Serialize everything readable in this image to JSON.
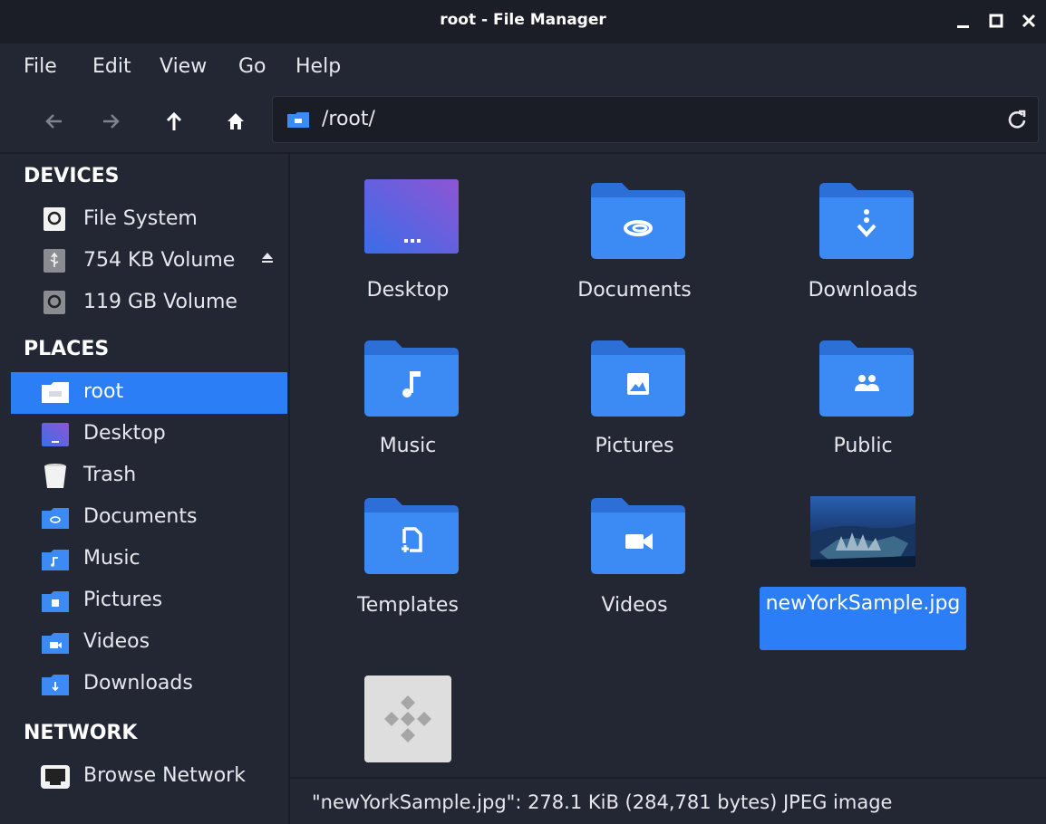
{
  "window": {
    "title": "root - File Manager"
  },
  "menu": {
    "items": [
      "File",
      "Edit",
      "View",
      "Go",
      "Help"
    ]
  },
  "toolbar": {
    "path": "/root/"
  },
  "sidebar": {
    "devices_heading": "DEVICES",
    "devices": [
      {
        "label": "File System",
        "icon": "drive-icon"
      },
      {
        "label": "754 KB Volume",
        "icon": "usb-drive-icon",
        "eject": true
      },
      {
        "label": "119 GB Volume",
        "icon": "drive-icon"
      }
    ],
    "places_heading": "PLACES",
    "places": [
      {
        "label": "root",
        "icon": "home-folder-icon",
        "selected": true
      },
      {
        "label": "Desktop",
        "icon": "desktop-folder-icon"
      },
      {
        "label": "Trash",
        "icon": "trash-icon"
      },
      {
        "label": "Documents",
        "icon": "documents-folder-icon"
      },
      {
        "label": "Music",
        "icon": "music-folder-icon"
      },
      {
        "label": "Pictures",
        "icon": "pictures-folder-icon"
      },
      {
        "label": "Videos",
        "icon": "videos-folder-icon"
      },
      {
        "label": "Downloads",
        "icon": "downloads-folder-icon"
      }
    ],
    "network_heading": "NETWORK",
    "network": [
      {
        "label": "Browse Network",
        "icon": "network-icon"
      }
    ]
  },
  "files": {
    "items": [
      {
        "name": "Desktop",
        "icon": "desktop-folder-icon"
      },
      {
        "name": "Documents",
        "icon": "documents-folder-icon"
      },
      {
        "name": "Downloads",
        "icon": "downloads-folder-icon"
      },
      {
        "name": "Music",
        "icon": "music-folder-icon"
      },
      {
        "name": "Pictures",
        "icon": "pictures-folder-icon"
      },
      {
        "name": "Public",
        "icon": "public-folder-icon"
      },
      {
        "name": "Templates",
        "icon": "templates-folder-icon"
      },
      {
        "name": "Videos",
        "icon": "videos-folder-icon"
      },
      {
        "name": "newYorkSample.jpg",
        "icon": "image-thumbnail-icon",
        "selected": true
      },
      {
        "name": "",
        "icon": "executable-file-icon"
      }
    ]
  },
  "status": {
    "text": "\"newYorkSample.jpg\": 278.1 KiB (284,781 bytes) JPEG image"
  },
  "colors": {
    "accent": "#2b7ef5",
    "folder": "#3c8bf5",
    "background": "#232733"
  }
}
